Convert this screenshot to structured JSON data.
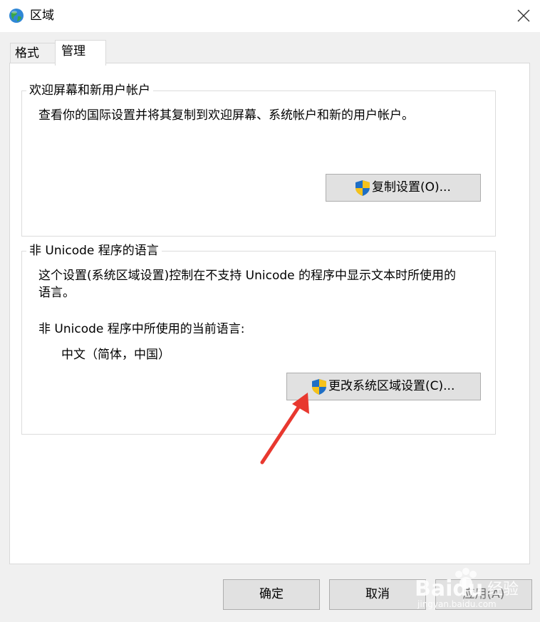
{
  "window": {
    "title": "区域"
  },
  "tabs": [
    {
      "label": "格式"
    },
    {
      "label": "管理"
    }
  ],
  "welcome_group": {
    "title": "欢迎屏幕和新用户帐户",
    "description": "查看你的国际设置并将其复制到欢迎屏幕、系统帐户和新的用户帐户。",
    "button_label": "复制设置(O)..."
  },
  "nonunicode_group": {
    "title": "非 Unicode 程序的语言",
    "description_line1": "这个设置(系统区域设置)控制在不支持 Unicode 的程序中显示文本时所使用的",
    "description_line2": "语言。",
    "current_label": "非 Unicode 程序中所使用的当前语言:",
    "current_value": "中文（简体，中国）",
    "button_label": "更改系统区域设置(C)..."
  },
  "footer": {
    "ok_label": "确定",
    "cancel_label": "取消",
    "apply_label": "应用(A)"
  },
  "watermark": {
    "brand": "Baidu",
    "brand_cn": "经验",
    "url": "jingyan.baidu.com"
  },
  "colors": {
    "accent_arrow": "#e8382f",
    "shield_blue": "#1f6fc5",
    "shield_yellow": "#f5c21b"
  }
}
